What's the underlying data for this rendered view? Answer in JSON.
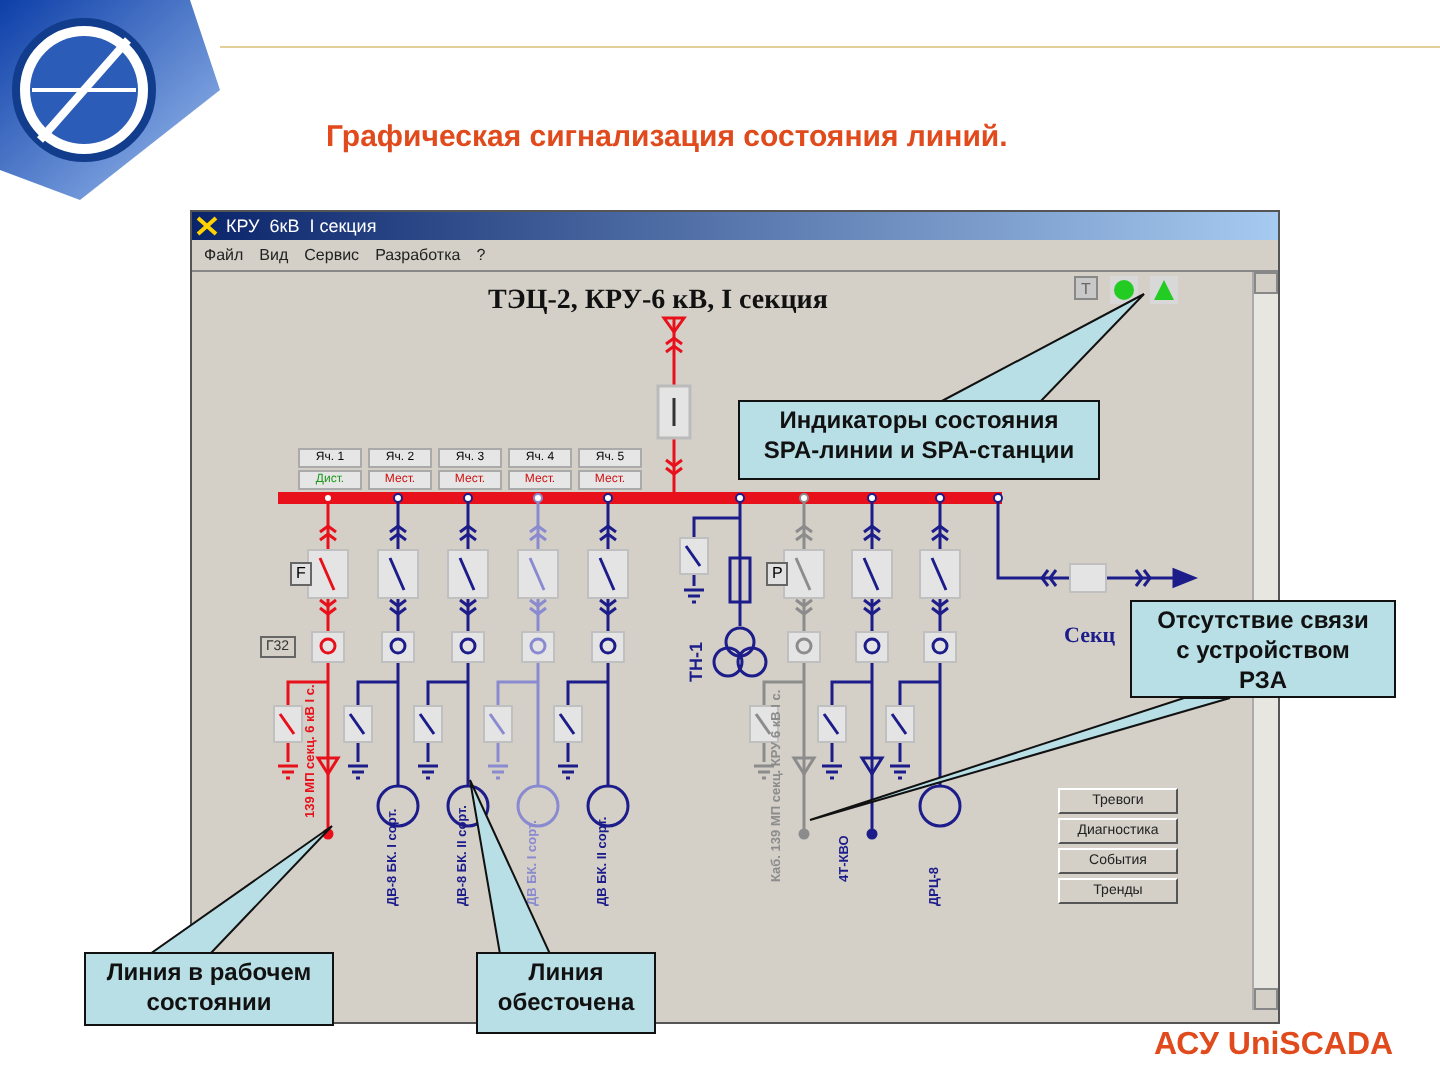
{
  "slide_title": "Графическая сигнализация состояния линий.",
  "window": {
    "title": "КРУ  6кВ  I секция",
    "menu": [
      "Файл",
      "Вид",
      "Сервис",
      "Разработка",
      "?"
    ],
    "diagram_title": "ТЭЦ-2, КРУ-6 кВ, I секция",
    "indicators": [
      {
        "kind": "button",
        "label": "T"
      },
      {
        "kind": "circle",
        "color": "#22cc22"
      },
      {
        "kind": "triangle",
        "color": "#22cc22"
      }
    ],
    "cells": [
      {
        "label": "Яч. 1",
        "mode": "Дист.",
        "remote": true
      },
      {
        "label": "Яч. 2",
        "mode": "Мест.",
        "remote": false
      },
      {
        "label": "Яч. 3",
        "mode": "Мест.",
        "remote": false
      },
      {
        "label": "Яч. 4",
        "mode": "Мест.",
        "remote": false
      },
      {
        "label": "Яч. 5",
        "mode": "Мест.",
        "remote": false
      }
    ],
    "incoming": {
      "energized": true
    },
    "bus": {
      "energized": true
    },
    "feeders": [
      {
        "kind": "cable",
        "energized": true,
        "linked": true,
        "dimmed": false,
        "tag": "F",
        "meter": "Г32",
        "label": "139 МП секц. 6 кВ I с."
      },
      {
        "kind": "motor",
        "energized": false,
        "linked": true,
        "dimmed": false,
        "label": "ДВ-8 БК. I сорт."
      },
      {
        "kind": "motor",
        "energized": false,
        "linked": true,
        "dimmed": false,
        "label": "ДВ-8 БК. II сорт."
      },
      {
        "kind": "motor",
        "energized": false,
        "linked": true,
        "dimmed": true,
        "label": "ДВ БК. I сорт."
      },
      {
        "kind": "motor",
        "energized": false,
        "linked": true,
        "dimmed": false,
        "label": "ДВ БК. II сорт."
      },
      {
        "kind": "transformer",
        "energized": false,
        "linked": true,
        "dimmed": false,
        "label": "ТН-1"
      },
      {
        "kind": "cable",
        "energized": false,
        "linked": false,
        "dimmed": false,
        "tag": "P",
        "label": "Каб. 139 МП секц. КРУ 6 кВ I с."
      },
      {
        "kind": "cable",
        "energized": false,
        "linked": true,
        "dimmed": false,
        "label": "4Т-КВО"
      },
      {
        "kind": "motor",
        "energized": false,
        "linked": true,
        "dimmed": false,
        "label": "ДРЦ-8"
      },
      {
        "kind": "section",
        "energized": false,
        "linked": true,
        "dimmed": false,
        "label": "Секц"
      }
    ],
    "buttons": [
      "Тревоги",
      "Диагностика",
      "События",
      "Тренды"
    ]
  },
  "callouts": [
    "Индикаторы состояния\nSPA-линии и SPA-станции",
    "Отсутствие связи\nс устройством\nРЗА",
    "Линия в рабочем\nсостоянии",
    "Линия\nобесточена"
  ],
  "brand": "АСУ UniSCADA"
}
